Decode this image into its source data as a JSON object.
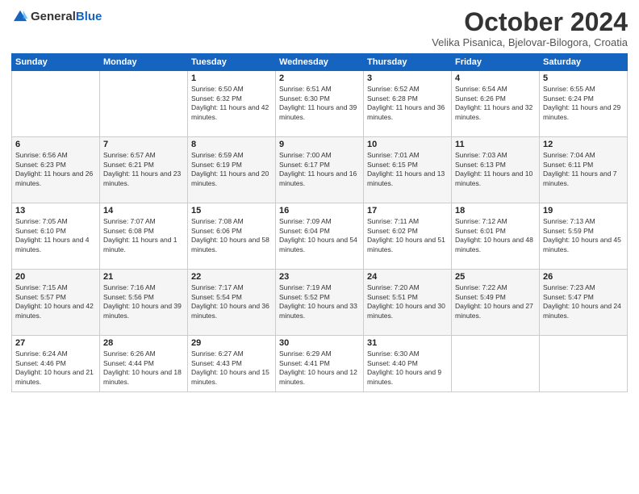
{
  "header": {
    "logo_general": "General",
    "logo_blue": "Blue",
    "title": "October 2024",
    "subtitle": "Velika Pisanica, Bjelovar-Bilogora, Croatia"
  },
  "days": [
    "Sunday",
    "Monday",
    "Tuesday",
    "Wednesday",
    "Thursday",
    "Friday",
    "Saturday"
  ],
  "weeks": [
    [
      {
        "date": "",
        "info": ""
      },
      {
        "date": "",
        "info": ""
      },
      {
        "date": "1",
        "info": "Sunrise: 6:50 AM\nSunset: 6:32 PM\nDaylight: 11 hours and 42 minutes."
      },
      {
        "date": "2",
        "info": "Sunrise: 6:51 AM\nSunset: 6:30 PM\nDaylight: 11 hours and 39 minutes."
      },
      {
        "date": "3",
        "info": "Sunrise: 6:52 AM\nSunset: 6:28 PM\nDaylight: 11 hours and 36 minutes."
      },
      {
        "date": "4",
        "info": "Sunrise: 6:54 AM\nSunset: 6:26 PM\nDaylight: 11 hours and 32 minutes."
      },
      {
        "date": "5",
        "info": "Sunrise: 6:55 AM\nSunset: 6:24 PM\nDaylight: 11 hours and 29 minutes."
      }
    ],
    [
      {
        "date": "6",
        "info": "Sunrise: 6:56 AM\nSunset: 6:23 PM\nDaylight: 11 hours and 26 minutes."
      },
      {
        "date": "7",
        "info": "Sunrise: 6:57 AM\nSunset: 6:21 PM\nDaylight: 11 hours and 23 minutes."
      },
      {
        "date": "8",
        "info": "Sunrise: 6:59 AM\nSunset: 6:19 PM\nDaylight: 11 hours and 20 minutes."
      },
      {
        "date": "9",
        "info": "Sunrise: 7:00 AM\nSunset: 6:17 PM\nDaylight: 11 hours and 16 minutes."
      },
      {
        "date": "10",
        "info": "Sunrise: 7:01 AM\nSunset: 6:15 PM\nDaylight: 11 hours and 13 minutes."
      },
      {
        "date": "11",
        "info": "Sunrise: 7:03 AM\nSunset: 6:13 PM\nDaylight: 11 hours and 10 minutes."
      },
      {
        "date": "12",
        "info": "Sunrise: 7:04 AM\nSunset: 6:11 PM\nDaylight: 11 hours and 7 minutes."
      }
    ],
    [
      {
        "date": "13",
        "info": "Sunrise: 7:05 AM\nSunset: 6:10 PM\nDaylight: 11 hours and 4 minutes."
      },
      {
        "date": "14",
        "info": "Sunrise: 7:07 AM\nSunset: 6:08 PM\nDaylight: 11 hours and 1 minute."
      },
      {
        "date": "15",
        "info": "Sunrise: 7:08 AM\nSunset: 6:06 PM\nDaylight: 10 hours and 58 minutes."
      },
      {
        "date": "16",
        "info": "Sunrise: 7:09 AM\nSunset: 6:04 PM\nDaylight: 10 hours and 54 minutes."
      },
      {
        "date": "17",
        "info": "Sunrise: 7:11 AM\nSunset: 6:02 PM\nDaylight: 10 hours and 51 minutes."
      },
      {
        "date": "18",
        "info": "Sunrise: 7:12 AM\nSunset: 6:01 PM\nDaylight: 10 hours and 48 minutes."
      },
      {
        "date": "19",
        "info": "Sunrise: 7:13 AM\nSunset: 5:59 PM\nDaylight: 10 hours and 45 minutes."
      }
    ],
    [
      {
        "date": "20",
        "info": "Sunrise: 7:15 AM\nSunset: 5:57 PM\nDaylight: 10 hours and 42 minutes."
      },
      {
        "date": "21",
        "info": "Sunrise: 7:16 AM\nSunset: 5:56 PM\nDaylight: 10 hours and 39 minutes."
      },
      {
        "date": "22",
        "info": "Sunrise: 7:17 AM\nSunset: 5:54 PM\nDaylight: 10 hours and 36 minutes."
      },
      {
        "date": "23",
        "info": "Sunrise: 7:19 AM\nSunset: 5:52 PM\nDaylight: 10 hours and 33 minutes."
      },
      {
        "date": "24",
        "info": "Sunrise: 7:20 AM\nSunset: 5:51 PM\nDaylight: 10 hours and 30 minutes."
      },
      {
        "date": "25",
        "info": "Sunrise: 7:22 AM\nSunset: 5:49 PM\nDaylight: 10 hours and 27 minutes."
      },
      {
        "date": "26",
        "info": "Sunrise: 7:23 AM\nSunset: 5:47 PM\nDaylight: 10 hours and 24 minutes."
      }
    ],
    [
      {
        "date": "27",
        "info": "Sunrise: 6:24 AM\nSunset: 4:46 PM\nDaylight: 10 hours and 21 minutes."
      },
      {
        "date": "28",
        "info": "Sunrise: 6:26 AM\nSunset: 4:44 PM\nDaylight: 10 hours and 18 minutes."
      },
      {
        "date": "29",
        "info": "Sunrise: 6:27 AM\nSunset: 4:43 PM\nDaylight: 10 hours and 15 minutes."
      },
      {
        "date": "30",
        "info": "Sunrise: 6:29 AM\nSunset: 4:41 PM\nDaylight: 10 hours and 12 minutes."
      },
      {
        "date": "31",
        "info": "Sunrise: 6:30 AM\nSunset: 4:40 PM\nDaylight: 10 hours and 9 minutes."
      },
      {
        "date": "",
        "info": ""
      },
      {
        "date": "",
        "info": ""
      }
    ]
  ]
}
